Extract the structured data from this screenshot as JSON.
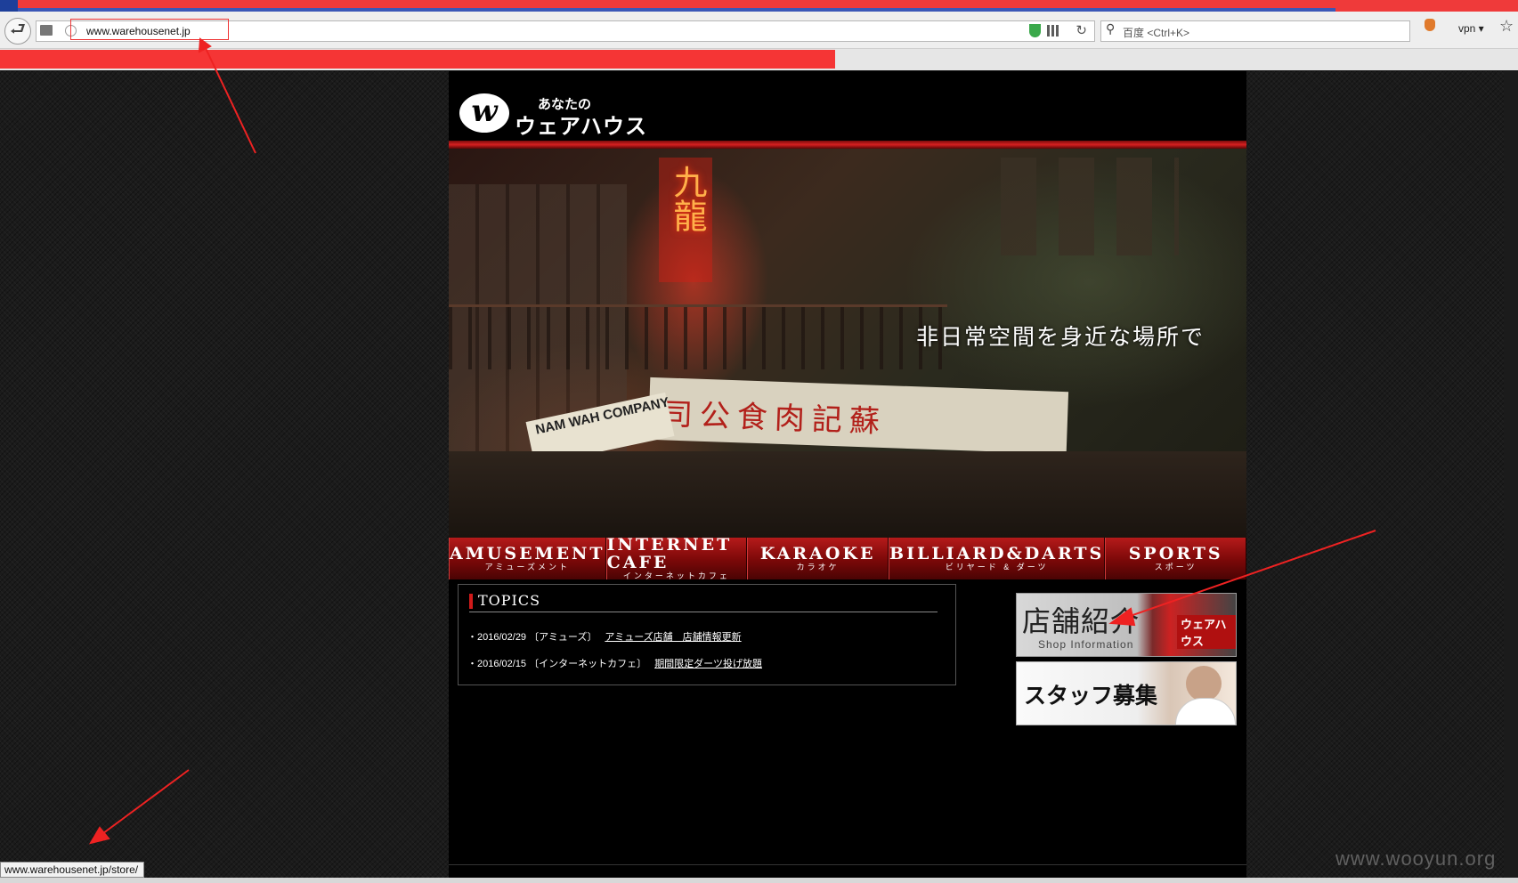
{
  "browser": {
    "address": "www.warehousenet.jp",
    "search_placeholder": "百度 <Ctrl+K>",
    "vpn_label": "vpn ▾",
    "status_url": "www.warehousenet.jp/store/",
    "icons": [
      "back-icon",
      "page-icon",
      "globe-icon",
      "shield-icon",
      "qr-icon",
      "reload-icon",
      "search-icon",
      "extension-icon",
      "star-icon"
    ]
  },
  "site": {
    "logo_mark": "w",
    "logo_small": "あなたの",
    "logo_big": "ウェアハウス",
    "hero": {
      "neon_sign": "九龍",
      "sign_main": "司公食肉記蘇",
      "sign_company": "NAM WAH COMPANY",
      "caption": "非日常空間を身近な場所で"
    },
    "nav": [
      {
        "en": "AMUSEMENT",
        "jp": "アミューズメント"
      },
      {
        "en": "INTERNET CAFE",
        "jp": "インターネットカフェ"
      },
      {
        "en": "KARAOKE",
        "jp": "カラオケ"
      },
      {
        "en": "BILLIARD&DARTS",
        "jp": "ビリヤード & ダーツ"
      },
      {
        "en": "SPORTS",
        "jp": "スポーツ"
      }
    ],
    "topics": {
      "title": "TOPICS",
      "items": [
        {
          "date": "・2016/02/29",
          "category": "〔アミューズ〕",
          "link": "アミューズ店舗　店舗情報更新"
        },
        {
          "date": "・2016/02/15",
          "category": "〔インターネットカフェ〕",
          "link": "期間限定ダーツ投げ放題"
        }
      ]
    },
    "banners": {
      "store_title": "店舗紹介",
      "store_sub": "Shop Information",
      "store_sign": "ウェアハウス",
      "staff_title": "スタッフ募集"
    }
  },
  "watermark": "www.wooyun.org",
  "colors": {
    "accent_red": "#d01a1a",
    "annotation_red": "#ee2222",
    "loadbar": "#f53535"
  }
}
